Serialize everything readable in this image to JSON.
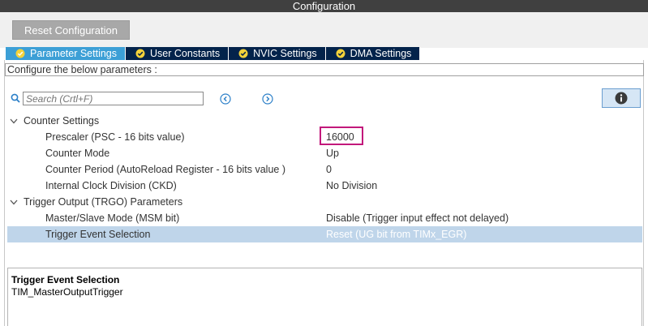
{
  "window": {
    "title": "Configuration"
  },
  "toolbar": {
    "reset_label": "Reset Configuration"
  },
  "tabs": [
    {
      "label": "Parameter Settings",
      "active": true
    },
    {
      "label": "User Constants",
      "active": false
    },
    {
      "label": "NVIC Settings",
      "active": false
    },
    {
      "label": "DMA Settings",
      "active": false
    }
  ],
  "configure_label": "Configure the below parameters :",
  "search": {
    "placeholder": "Search (Crtl+F)"
  },
  "groups": {
    "counter": {
      "label": "Counter Settings",
      "params": [
        {
          "label": "Prescaler (PSC - 16 bits value)",
          "value": "16000"
        },
        {
          "label": "Counter Mode",
          "value": "Up"
        },
        {
          "label": "Counter Period (AutoReload Register - 16 bits value )",
          "value": "0"
        },
        {
          "label": "Internal Clock Division (CKD)",
          "value": "No Division"
        }
      ]
    },
    "trigger": {
      "label": "Trigger Output (TRGO) Parameters",
      "params": [
        {
          "label": "Master/Slave Mode (MSM bit)",
          "value": "Disable (Trigger input effect not delayed)"
        },
        {
          "label": "Trigger Event Selection",
          "value": "Reset (UG bit from TIMx_EGR)"
        }
      ]
    }
  },
  "description": {
    "title": "Trigger Event Selection",
    "text": "TIM_MasterOutputTrigger"
  },
  "colors": {
    "tab_active": "#3c9fd6",
    "tab_inactive": "#03234b",
    "selected_row": "#bfd5ea",
    "highlight_border": "#c2187b"
  },
  "icons": {
    "tab_check": "check-circle-icon",
    "search": "search-icon",
    "previous": "chevron-left-circle-icon",
    "next": "chevron-right-circle-icon",
    "info": "info-icon",
    "expand": "chevron-down-icon"
  }
}
